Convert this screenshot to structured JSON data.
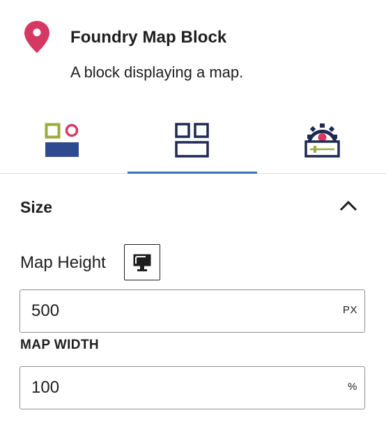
{
  "block": {
    "title": "Foundry Map Block",
    "description": "A block displaying a map.",
    "icon": "map-pin-icon",
    "icon_color": "#d63864"
  },
  "tabs": [
    {
      "name": "style",
      "icon": "style-shapes-icon",
      "active": false
    },
    {
      "name": "layout",
      "icon": "layout-grid-icon",
      "active": true
    },
    {
      "name": "advanced",
      "icon": "advanced-gear-slider-icon",
      "active": false
    }
  ],
  "accent_color": "#3871b5",
  "section": {
    "title": "Size",
    "expanded": true,
    "map_height": {
      "label": "Map Height",
      "device_icon": "desktop-icon",
      "value": "500",
      "unit": "PX"
    },
    "map_width": {
      "label": "MAP WIDTH",
      "value": "100",
      "unit": "%"
    }
  }
}
